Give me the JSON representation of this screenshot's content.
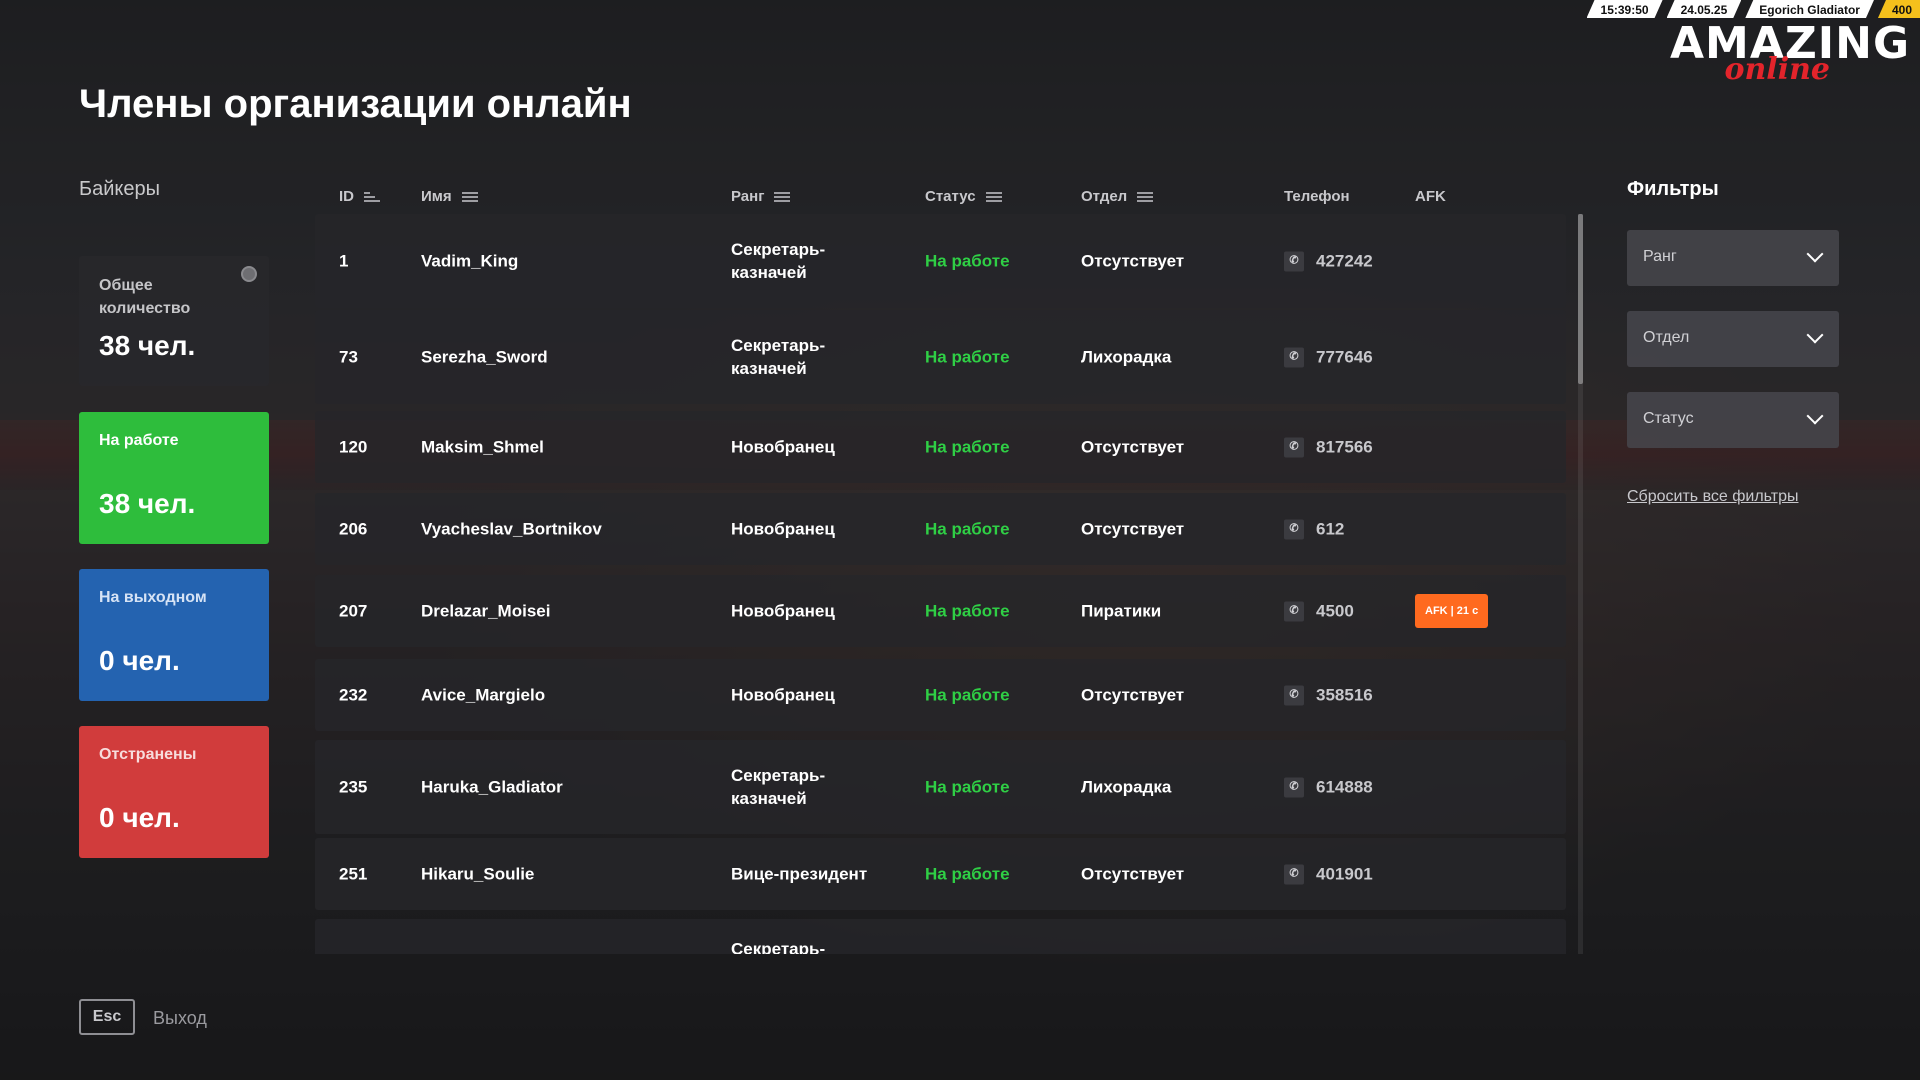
{
  "topbar": {
    "time": "15:39:50",
    "date": "24.05.25",
    "player": "Egorich Gladiator",
    "money": "400"
  },
  "logo": {
    "word": "AMAZING",
    "script": "online"
  },
  "page_title": "Члены организации онлайн",
  "organization": "Байкеры",
  "cards": {
    "total": {
      "label": "Общее количество",
      "value": "38 чел."
    },
    "working": {
      "label": "На работе",
      "value": "38 чел."
    },
    "day_off": {
      "label": "На выходном",
      "value": "0 чел."
    },
    "suspended": {
      "label": "Отстранены",
      "value": "0 чел."
    }
  },
  "table": {
    "headers": {
      "id": "ID",
      "name": "Имя",
      "rank": "Ранг",
      "status": "Статус",
      "dept": "Отдел",
      "phone": "Телефон",
      "afk": "AFK"
    },
    "rows": [
      {
        "id": "1",
        "name": "Vadim_King",
        "rank": "Секретарь-казначей",
        "status": "На работе",
        "dept": "Отсутствует",
        "phone": "427242",
        "afk": ""
      },
      {
        "id": "73",
        "name": "Serezha_Sword",
        "rank": "Секретарь-казначей",
        "status": "На работе",
        "dept": "Лихорадка",
        "phone": "777646",
        "afk": ""
      },
      {
        "id": "120",
        "name": "Maksim_Shmel",
        "rank": "Новобранец",
        "status": "На работе",
        "dept": "Отсутствует",
        "phone": "817566",
        "afk": ""
      },
      {
        "id": "206",
        "name": "Vyacheslav_Bortnikov",
        "rank": "Новобранец",
        "status": "На работе",
        "dept": "Отсутствует",
        "phone": "612",
        "afk": ""
      },
      {
        "id": "207",
        "name": "Drelazar_Moisei",
        "rank": "Новобранец",
        "status": "На работе",
        "dept": "Пиратики",
        "phone": "4500",
        "afk": "AFK | 21 с"
      },
      {
        "id": "232",
        "name": "Avice_Margielo",
        "rank": "Новобранец",
        "status": "На работе",
        "dept": "Отсутствует",
        "phone": "358516",
        "afk": ""
      },
      {
        "id": "235",
        "name": "Haruka_Gladiator",
        "rank": "Секретарь-казначей",
        "status": "На работе",
        "dept": "Лихорадка",
        "phone": "614888",
        "afk": ""
      },
      {
        "id": "251",
        "name": "Hikaru_Soulie",
        "rank": "Вице-президент",
        "status": "На работе",
        "dept": "Отсутствует",
        "phone": "401901",
        "afk": ""
      },
      {
        "id": "",
        "name": "",
        "rank": "Секретарь-",
        "status": "",
        "dept": "",
        "phone": "",
        "afk": ""
      }
    ]
  },
  "filters": {
    "title": "Фильтры",
    "rank": "Ранг",
    "dept": "Отдел",
    "status": "Статус",
    "reset": "Сбросить все фильтры"
  },
  "footer": {
    "esc_key": "Esc",
    "exit_label": "Выход"
  }
}
